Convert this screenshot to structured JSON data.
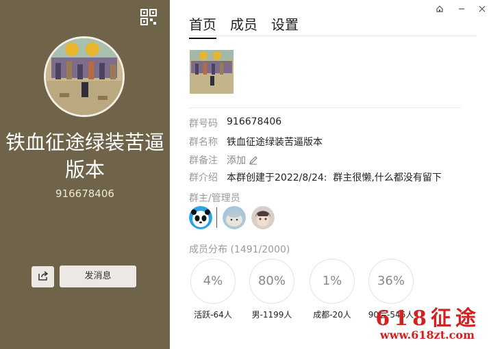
{
  "group": {
    "name": "铁血征途绿装苦逼版本",
    "id": "916678406"
  },
  "left_actions": {
    "share_icon": "share-icon",
    "message_label": "发消息"
  },
  "tabs": [
    "首页",
    "成员",
    "设置"
  ],
  "info": {
    "group_number_label": "群号码",
    "group_number": "916678406",
    "group_name_label": "群名称",
    "group_name": "铁血征途绿装苦逼版本",
    "remark_label": "群备注",
    "remark_add": "添加",
    "intro_label": "群介绍",
    "intro": "本群创建于2022/8/24:  群主很懒,什么都没有留下"
  },
  "admins": {
    "label": "群主/管理员"
  },
  "distribution": {
    "label": "成员分布 (1491/2000)",
    "stats": [
      {
        "value": "4%",
        "caption": "活跃-64人"
      },
      {
        "value": "80%",
        "caption": "男-1199人"
      },
      {
        "value": "1%",
        "caption": "成都-20人"
      },
      {
        "value": "36%",
        "caption": "90后-546人"
      }
    ]
  },
  "watermark": {
    "big": "618征途",
    "url": "www.618zt.com"
  },
  "colors": {
    "left_panel": "#6f6349",
    "watermark": "#d52020"
  }
}
